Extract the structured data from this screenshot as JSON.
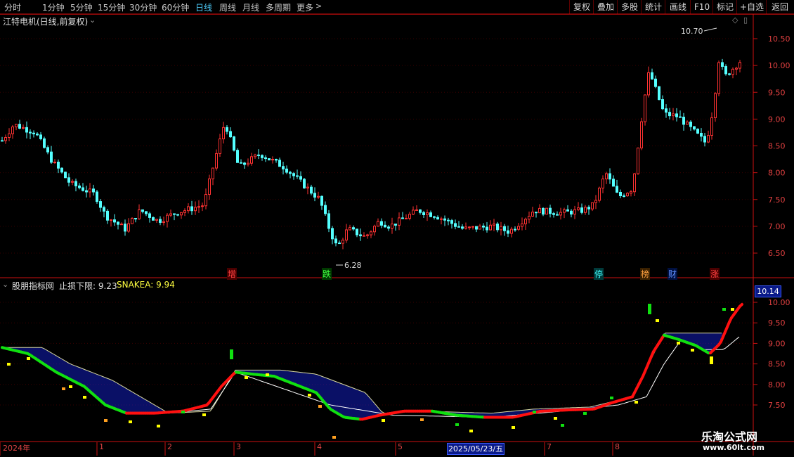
{
  "toolbar": {
    "periods": [
      "分时",
      "1分钟",
      "5分钟",
      "15分钟",
      "30分钟",
      "60分钟",
      "日线",
      "周线",
      "月线",
      "多周期",
      "更多"
    ],
    "active_period": "日线",
    "right_buttons": [
      "复权",
      "叠加",
      "多股",
      "统计",
      "画线",
      "F10",
      "标记",
      "+自选",
      "返回"
    ]
  },
  "main_chart": {
    "title": "江特电机(日线,前复权)",
    "high_label": "10.70",
    "low_label": "6.28",
    "price_ticks": [
      "10.50",
      "10.00",
      "9.50",
      "9.00",
      "8.50",
      "8.00",
      "7.50",
      "7.00",
      "6.50"
    ],
    "event_markers": [
      {
        "text": "增",
        "color": "#ff4040",
        "bg": "#4a0000"
      },
      {
        "text": "跌",
        "color": "#40ff40",
        "bg": "#003a00"
      },
      {
        "text": "停",
        "color": "#40ffff",
        "bg": "#003a3a"
      },
      {
        "text": "榜",
        "color": "#ffa040",
        "bg": "#3a2000"
      },
      {
        "text": "财",
        "color": "#6090ff",
        "bg": "#001040"
      },
      {
        "text": "涨",
        "color": "#ff4040",
        "bg": "#4a0000"
      }
    ]
  },
  "indicator": {
    "name": "股朋指标网",
    "line1_label": "止损下限: 9.23",
    "line2_label": "SNAKEA: 9.94",
    "current_value": "10.14",
    "ticks": [
      "10.00",
      "9.50",
      "9.00",
      "8.50",
      "8.00",
      "7.50"
    ]
  },
  "date_axis": {
    "labels": [
      "2024年",
      "1",
      "2",
      "3",
      "4",
      "5",
      "7",
      "8"
    ],
    "selected_date": "2025/05/23/五"
  },
  "watermark": {
    "line1": "乐淘公式网",
    "line2": "www.60lt.com"
  },
  "colors": {
    "up": "#ff3232",
    "down": "#54ffff",
    "axis": "#cc1010",
    "indicator_up": "#ff1010",
    "indicator_down": "#10e010",
    "band_fill": "#1a2aff"
  }
}
